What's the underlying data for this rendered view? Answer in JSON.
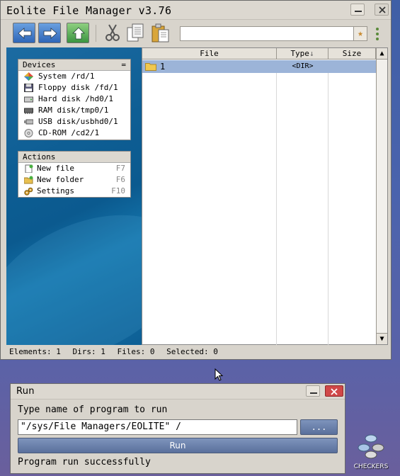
{
  "file_manager": {
    "title": "Eolite File Manager v3.76",
    "toolbar": {
      "path_value": "",
      "buttons": [
        "back",
        "forward",
        "up",
        "cut",
        "copy",
        "paste"
      ]
    },
    "devices": {
      "header": "Devices",
      "header_button": "=",
      "items": [
        {
          "label": "System /rd/1",
          "icon": "system-icon"
        },
        {
          "label": "Floppy disk /fd/1",
          "icon": "floppy-icon"
        },
        {
          "label": "Hard disk /hd0/1",
          "icon": "harddisk-icon"
        },
        {
          "label": "RAM disk/tmp0/1",
          "icon": "ramdisk-icon"
        },
        {
          "label": "USB disk/usbhd0/1",
          "icon": "usb-icon"
        },
        {
          "label": "CD-ROM /cd2/1",
          "icon": "cdrom-icon"
        }
      ]
    },
    "actions": {
      "header": "Actions",
      "items": [
        {
          "label": "New file",
          "key": "F7",
          "icon": "new-file-icon"
        },
        {
          "label": "New folder",
          "key": "F6",
          "icon": "new-folder-icon"
        },
        {
          "label": "Settings",
          "key": "F10",
          "icon": "settings-icon"
        }
      ]
    },
    "file_list": {
      "columns": {
        "file": "File",
        "type": "Type",
        "type_sort": "↓",
        "size": "Size"
      },
      "rows": [
        {
          "name": "1",
          "type": "<DIR>",
          "size": ""
        }
      ]
    },
    "status": {
      "elements": "Elements: 1",
      "dirs": "Dirs: 1",
      "files": "Files: 0",
      "selected": "Selected: 0"
    }
  },
  "run_dialog": {
    "title": "Run",
    "prompt": "Type name of program to run",
    "input_value": "\"/sys/File Managers/EOLITE\" /",
    "browse_label": "...",
    "run_label": "Run",
    "status": "Program run successfully"
  },
  "desktop": {
    "icons": [
      {
        "label": "CHECKERS"
      }
    ]
  },
  "colors": {
    "selection": "#9cb4d8",
    "button_blue": "#6a80ac",
    "close_red": "#d04848"
  }
}
